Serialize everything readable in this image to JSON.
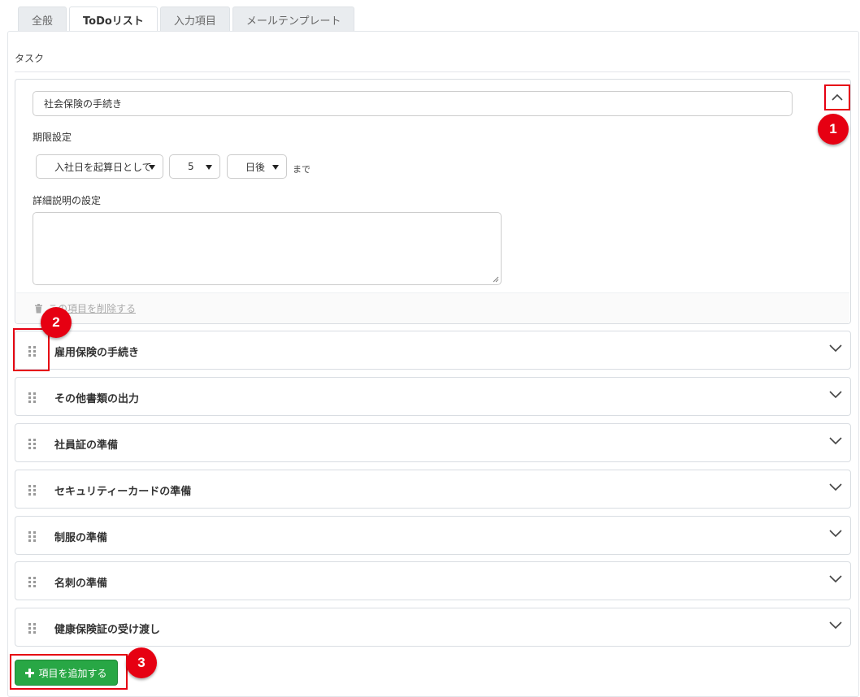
{
  "tabs": [
    {
      "label": "全般",
      "active": false
    },
    {
      "label": "ToDoリスト",
      "active": true
    },
    {
      "label": "入力項目",
      "active": false
    },
    {
      "label": "メールテンプレート",
      "active": false
    }
  ],
  "section_title": "タスク",
  "open_task": {
    "name_value": "社会保険の手続き",
    "deadline_label": "期限設定",
    "base_select": "入社日を起算日として",
    "number_select": "5",
    "unit_select": "日後",
    "until_text": "まで",
    "description_label": "詳細説明の設定",
    "description_value": "",
    "delete_label": "この項目を削除する"
  },
  "tasks": [
    "雇用保険の手続き",
    "その他書類の出力",
    "社員証の準備",
    "セキュリティーカードの準備",
    "制服の準備",
    "名刺の準備",
    "健康保険証の受け渡し"
  ],
  "add_button_label": "項目を追加する",
  "annotations": [
    "1",
    "2",
    "3"
  ],
  "colors": {
    "accent_red": "#e60012",
    "add_green": "#28a745"
  }
}
